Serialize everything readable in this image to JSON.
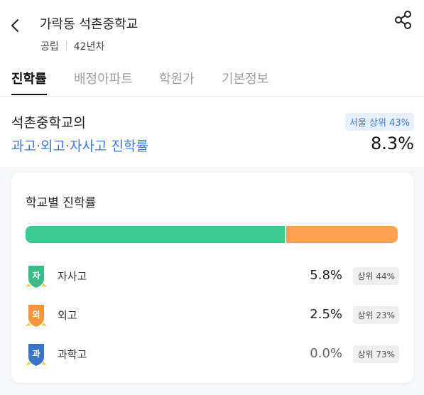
{
  "header": {
    "title": "가락동 석촌중학교",
    "school_type": "공립",
    "age": "42년차"
  },
  "tabs": [
    {
      "label": "진학률"
    },
    {
      "label": "배정아파트"
    },
    {
      "label": "학원가"
    },
    {
      "label": "기본정보"
    }
  ],
  "summary": {
    "heading": "석촌중학교의",
    "link_text": "과고·외고·자사고 진학률",
    "rank_badge": "서울 상위 43%",
    "value": "8.3%"
  },
  "card": {
    "title": "학교별 진학률",
    "bar": {
      "segments": [
        {
          "name": "자사고",
          "fraction": 0.7,
          "color": "#3cc993"
        },
        {
          "name": "외고",
          "fraction": 0.3,
          "color": "#ff9f50"
        }
      ]
    },
    "rows": [
      {
        "emblem_char": "자",
        "emblem_color": "#3cba87",
        "label": "자사고",
        "value": "5.8%",
        "rank": "상위 44%"
      },
      {
        "emblem_char": "외",
        "emblem_color": "#f7943f",
        "label": "외고",
        "value": "2.5%",
        "rank": "상위 23%"
      },
      {
        "emblem_char": "과",
        "emblem_color": "#3c73c4",
        "label": "과학고",
        "value": "0.0%",
        "rank": "상위 73%"
      }
    ]
  },
  "icons": {
    "back": "back-chevron-icon",
    "share": "share-icon"
  }
}
